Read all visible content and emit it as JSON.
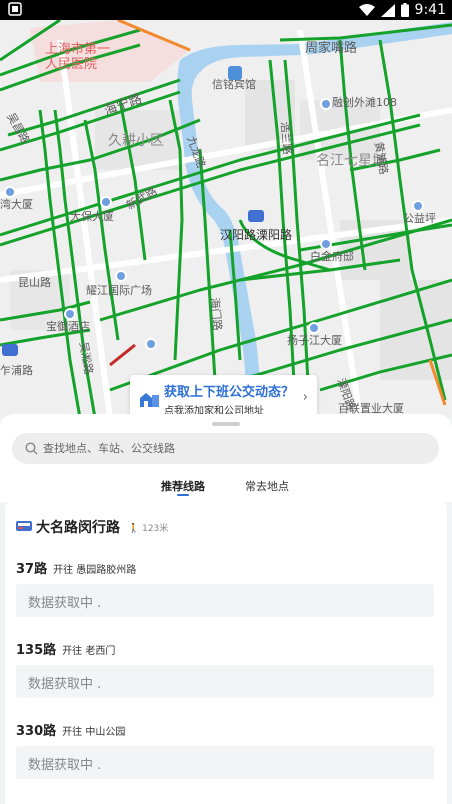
{
  "status_bar": {
    "time": "9:41"
  },
  "map": {
    "labels": {
      "hospital": "上海市第一\n人民医院",
      "zhoujiazui": "周家嘴路",
      "haining": "海宁路",
      "xinming": "信铭宾馆",
      "rongchuang": "融创外滩108",
      "jiugeng": "久耕小区",
      "mingjiang": "名江七星城",
      "wuchang": "吴昌路",
      "jiuding": "九龙路",
      "haolan": "浩兰路",
      "xinwu": "新武路",
      "wan": "湾大厦",
      "dabao": "大保大厦",
      "hanyang": "汉阳路溧阳路",
      "baijin": "白金府邸",
      "kunshan": "昆山路",
      "jiangguo": "耀江国际广场",
      "baoyu": "宝御酒店",
      "zhaping": "乍浦路",
      "yangzijiang": "扬子江大厦",
      "bailian": "百联置业大厦",
      "gongji": "公益坪",
      "wusong": "吴淞路",
      "qian": "黄浦路",
      "liyang": "溧阳路",
      "haimen": "海门路"
    },
    "commute_card": {
      "title": "获取上下班公交动态？",
      "subtitle": "点我添加家和公司地址"
    }
  },
  "sheet": {
    "search": {
      "placeholder": "查找地点、车站、公交线路"
    },
    "tabs": [
      {
        "label": "推荐线路",
        "active": true
      },
      {
        "label": "常去地点",
        "active": false
      }
    ],
    "stop": {
      "name": "大名路闵行路",
      "distance": "123米"
    },
    "routes": [
      {
        "number": "37路",
        "direction": "开往 愚园路胶州路",
        "status": "数据获取中 ."
      },
      {
        "number": "135路",
        "direction": "开往 老西门",
        "status": "数据获取中 ."
      },
      {
        "number": "330路",
        "direction": "开往 中山公园",
        "status": "数据获取中 ."
      }
    ]
  },
  "colors": {
    "traffic_green": "#14a22a",
    "traffic_orange": "#f08a2c",
    "water": "#a9d2f1",
    "accent_blue": "#2f6fd8"
  }
}
